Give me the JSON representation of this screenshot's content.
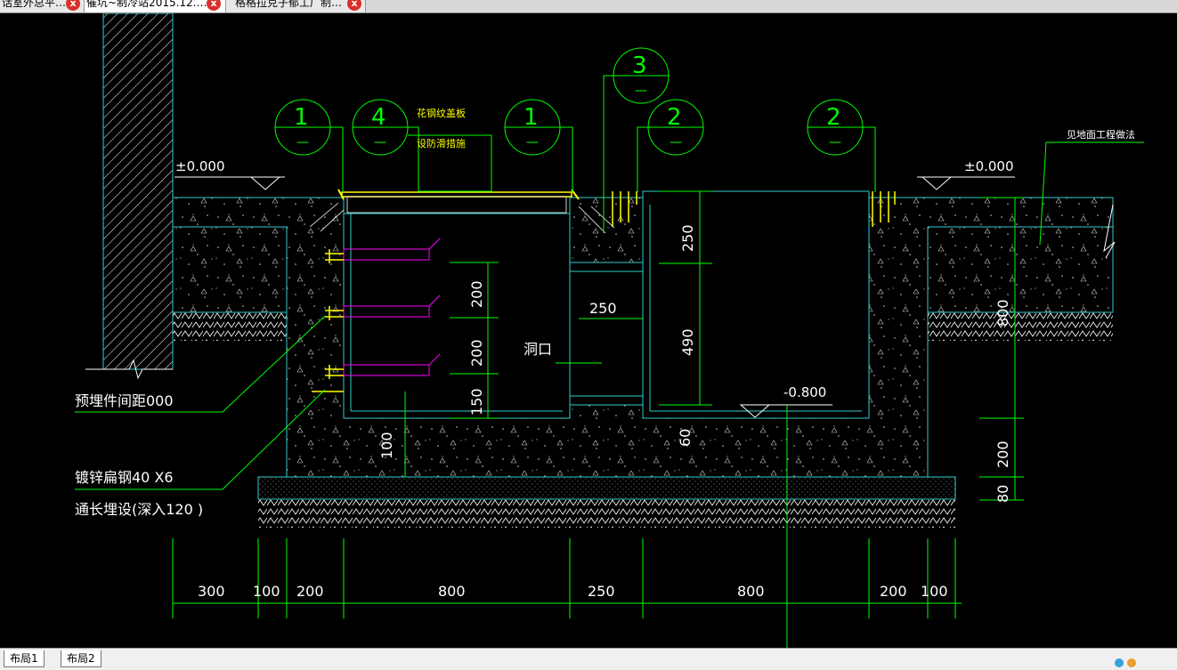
{
  "tabs": [
    {
      "label": "话室外总平…"
    },
    {
      "label": "催坑~制冷站2015.12.…"
    },
    {
      "label": "格格拉克子郁工厂制…"
    }
  ],
  "tab_close_glyph": "x",
  "layout_tabs": [
    {
      "label": "布局1"
    },
    {
      "label": "布局2"
    }
  ],
  "drawing": {
    "elev_left": "±0.000",
    "elev_right": "±0.000",
    "elev_bottom": "-0.800",
    "note_cover_1": "花钢纹盖板",
    "note_cover_2": "设防滑措施",
    "note_floor": "见地面工程做法",
    "note_embed": "预埋件间距000",
    "note_steel_1": "镀锌扁钢40  X6",
    "note_steel_2": "通长埋设(深入120 )",
    "hole_label": "洞口",
    "callouts": [
      {
        "num": "1",
        "sub": "—"
      },
      {
        "num": "4",
        "sub": "—"
      },
      {
        "num": "1",
        "sub": "—"
      },
      {
        "num": "3",
        "sub": "—"
      },
      {
        "num": "2",
        "sub": "—"
      },
      {
        "num": "2",
        "sub": "—"
      }
    ],
    "dims_bottom": [
      "300",
      "100",
      "200",
      "800",
      "250",
      "800",
      "200",
      "100"
    ],
    "dims_vertical": {
      "d250": "250",
      "d490": "490",
      "d200a": "200",
      "d200b": "200",
      "d150": "150",
      "d100": "100",
      "d60": "60",
      "d800": "800",
      "d200c": "200",
      "d80": "80"
    },
    "dim_250h": "250"
  }
}
